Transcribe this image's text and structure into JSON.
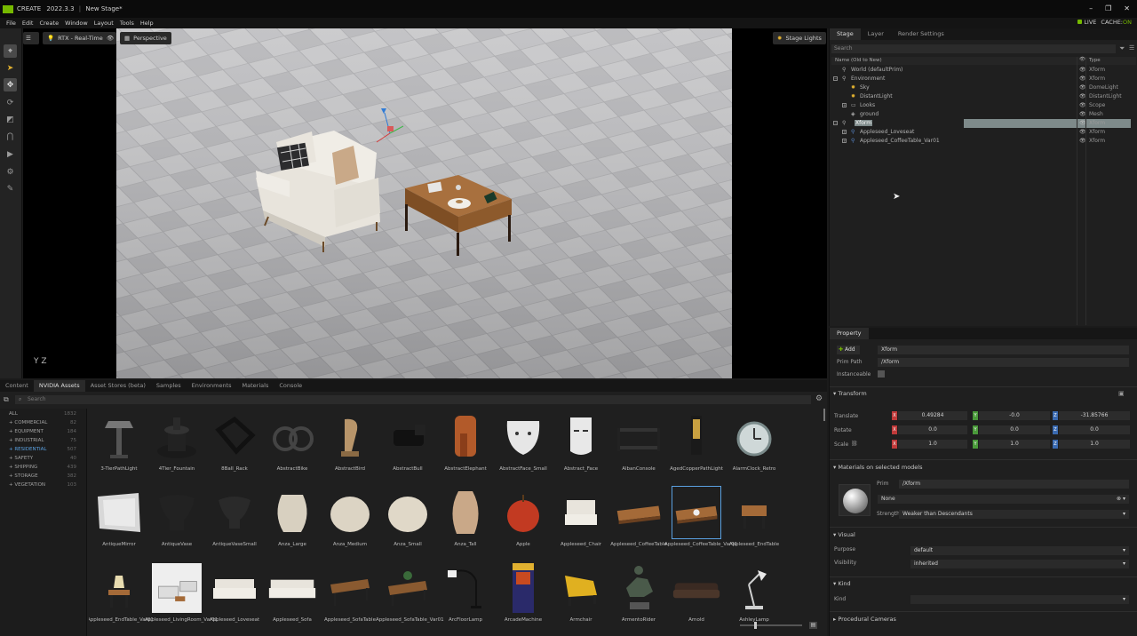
{
  "app": {
    "name": "CREATE",
    "version": "2022.3.3",
    "document": "New Stage*",
    "window_buttons": [
      "–",
      "❐",
      "✕"
    ]
  },
  "menu": [
    "File",
    "Edit",
    "Create",
    "Window",
    "Layout",
    "Tools",
    "Help"
  ],
  "status": {
    "live": "LIVE",
    "cache_label": "CACHE:",
    "cache_state": "ON"
  },
  "viewport": {
    "renderer": "RTX - Real-Time",
    "camera": "Perspective",
    "lights": "Stage Lights",
    "axis": "Y Z"
  },
  "stage": {
    "tabs": [
      "Stage",
      "Layer",
      "Render Settings"
    ],
    "search_placeholder": "Search",
    "col_name": "Name (Old to New)",
    "col_type": "Type",
    "rows": [
      {
        "name": "World (defaultPrim)",
        "type": "Xform"
      },
      {
        "name": "Environment",
        "type": "Xform"
      },
      {
        "name": "Sky",
        "type": "DomeLight"
      },
      {
        "name": "DistantLight",
        "type": "DistantLight"
      },
      {
        "name": "Looks",
        "type": "Scope"
      },
      {
        "name": "ground",
        "type": "Mesh"
      },
      {
        "name": "Xform",
        "type": "Xform"
      },
      {
        "name": "Appleseed_Loveseat",
        "type": "Xform"
      },
      {
        "name": "Appleseed_CoffeeTable_Var01",
        "type": "Xform"
      }
    ]
  },
  "property": {
    "tab": "Property",
    "add_label": "Add",
    "name_value": "Xform",
    "prim_path_label": "Prim Path",
    "prim_path_value": "/Xform",
    "instanceable_label": "Instanceable",
    "transform": {
      "title": "Transform",
      "translate_label": "Translate",
      "rotate_label": "Rotate",
      "scale_label": "Scale",
      "translate": [
        "0.49284",
        "-0.0",
        "-31.85766"
      ],
      "rotate": [
        "0.0",
        "0.0",
        "0.0"
      ],
      "scale": [
        "1.0",
        "1.0",
        "1.0"
      ],
      "axes": [
        "X",
        "Y",
        "Z"
      ]
    },
    "materials": {
      "title": "Materials on selected models",
      "prim_label": "Prim",
      "prim_value": "/Xform",
      "material_value": "None",
      "strength_label": "Strength",
      "strength_value": "Weaker than Descendants"
    },
    "visual": {
      "title": "Visual",
      "purpose_label": "Purpose",
      "purpose_value": "default",
      "visibility_label": "Visibility",
      "visibility_value": "inherited"
    },
    "kind": {
      "title": "Kind",
      "kind_label": "Kind",
      "kind_value": ""
    },
    "procedural": {
      "title": "Procedural Cameras"
    }
  },
  "content": {
    "tabs": [
      "Content",
      "NVIDIA Assets",
      "Asset Stores (beta)",
      "Samples",
      "Environments",
      "Materials",
      "Console"
    ],
    "search_placeholder": "Search",
    "categories": [
      {
        "name": "ALL",
        "count": "1832"
      },
      {
        "name": "+ COMMERCIAL",
        "count": "82"
      },
      {
        "name": "+ EQUIPMENT",
        "count": "184"
      },
      {
        "name": "+ INDUSTRIAL",
        "count": "75"
      },
      {
        "name": "+ RESIDENTIAL",
        "count": "507"
      },
      {
        "name": "+ SAFETY",
        "count": "40"
      },
      {
        "name": "+ SHIPPING",
        "count": "439"
      },
      {
        "name": "+ STORAGE",
        "count": "382"
      },
      {
        "name": "+ VEGETATION",
        "count": "103"
      }
    ],
    "assets": [
      "3-TierPathLight",
      "4Tier_Fountain",
      "8Ball_Rack",
      "AbstractBike",
      "AbstractBird",
      "AbstractBull",
      "AbstractElephant",
      "AbstractFace_Small",
      "Abstract_Face",
      "AlbanConsole",
      "AgedCopperPathLight",
      "AlarmClock_Retro",
      "AntiqueMirror",
      "AntiqueVase",
      "AntiqueVaseSmall",
      "Anza_Large",
      "Anza_Medium",
      "Anza_Small",
      "Anza_Tall",
      "Apple",
      "Appleseed_Chair",
      "Appleseed_CoffeeTable",
      "Appleseed_CoffeeTable_Var01",
      "Appleseed_EndTable",
      "Appleseed_EndTable_Var01",
      "Appleseed_LivingRoom_Var01",
      "Appleseed_Loveseat",
      "Appleseed_Sofa",
      "Appleseed_SofaTable",
      "Appleseed_SofaTable_Var01",
      "ArcFloorLamp",
      "ArcadeMachine",
      "Armchair",
      "ArmentoRider",
      "Arnold",
      "AshleyLamp"
    ]
  }
}
